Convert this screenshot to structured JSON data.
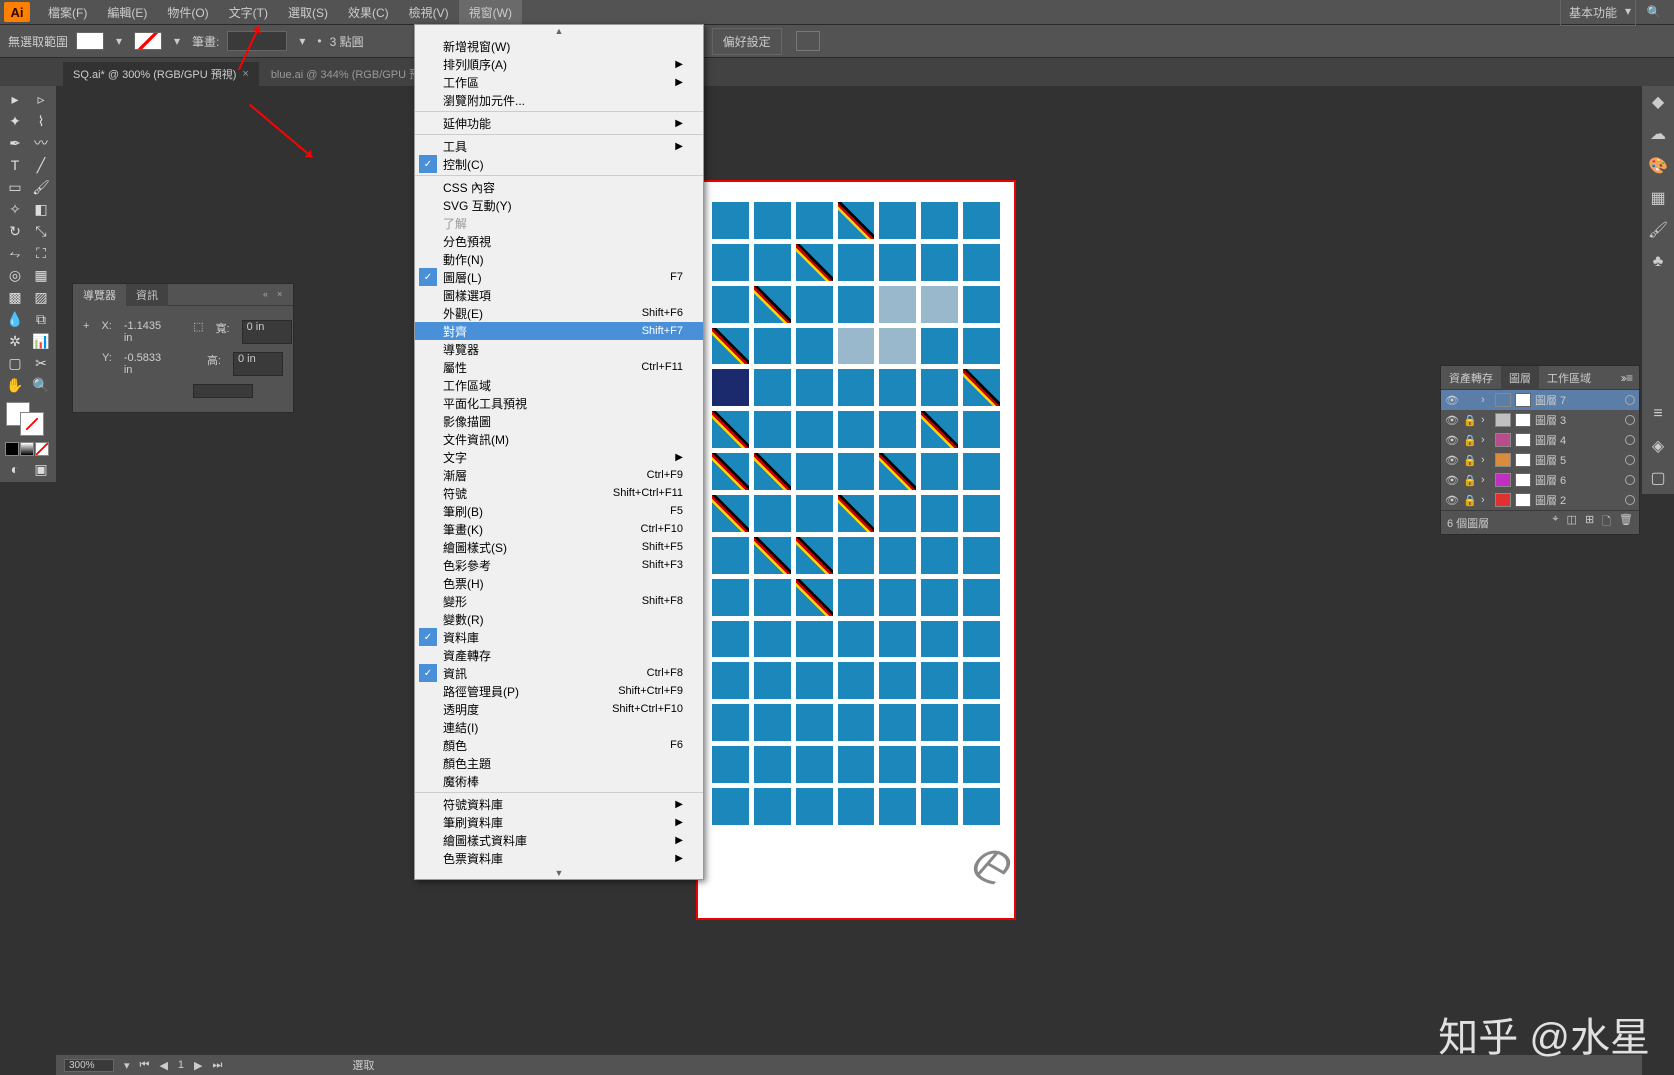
{
  "menubar": {
    "items": [
      "檔案(F)",
      "編輯(E)",
      "物件(O)",
      "文字(T)",
      "選取(S)",
      "效果(C)",
      "檢視(V)",
      "視窗(W)"
    ],
    "workspace": "基本功能"
  },
  "controlbar": {
    "label": "無選取範圍",
    "brush_label": "筆畫:",
    "stroke_value": "",
    "points": "3 點圓",
    "pref": "偏好設定"
  },
  "doctabs": {
    "tabs": [
      {
        "label": "SQ.ai* @ 300% (RGB/GPU 預視)",
        "active": true
      },
      {
        "label": "blue.ai @ 344% (RGB/GPU 預視)",
        "active": false
      }
    ]
  },
  "dropdown": {
    "items": [
      {
        "label": "新增視窗(W)"
      },
      {
        "label": "排列順序(A)",
        "sub": true
      },
      {
        "label": "工作區",
        "sub": true
      },
      {
        "label": "瀏覽附加元件..."
      },
      {
        "sep": true
      },
      {
        "label": "延伸功能",
        "sub": true
      },
      {
        "sep": true
      },
      {
        "label": "工具",
        "sub": true
      },
      {
        "label": "控制(C)",
        "checked": true
      },
      {
        "sep": true
      },
      {
        "label": "CSS 內容"
      },
      {
        "label": "SVG 互動(Y)"
      },
      {
        "label": "了解",
        "disabled": true
      },
      {
        "label": "分色預視"
      },
      {
        "label": "動作(N)"
      },
      {
        "label": "圖層(L)",
        "checked": true,
        "short": "F7"
      },
      {
        "label": "圖樣選項"
      },
      {
        "label": "外觀(E)",
        "short": "Shift+F6"
      },
      {
        "label": "對齊",
        "short": "Shift+F7",
        "highlight": true
      },
      {
        "label": "導覽器"
      },
      {
        "label": "屬性",
        "short": "Ctrl+F11"
      },
      {
        "label": "工作區域"
      },
      {
        "label": "平面化工具預視"
      },
      {
        "label": "影像描圖"
      },
      {
        "label": "文件資訊(M)"
      },
      {
        "label": "文字",
        "sub": true
      },
      {
        "label": "漸層",
        "short": "Ctrl+F9"
      },
      {
        "label": "符號",
        "short": "Shift+Ctrl+F11"
      },
      {
        "label": "筆刷(B)",
        "short": "F5"
      },
      {
        "label": "筆畫(K)",
        "short": "Ctrl+F10"
      },
      {
        "label": "繪圖樣式(S)",
        "short": "Shift+F5"
      },
      {
        "label": "色彩參考",
        "short": "Shift+F3"
      },
      {
        "label": "色票(H)"
      },
      {
        "label": "變形",
        "short": "Shift+F8"
      },
      {
        "label": "變數(R)"
      },
      {
        "label": "資料庫",
        "checked": true
      },
      {
        "label": "資產轉存"
      },
      {
        "label": "資訊",
        "checked": true,
        "short": "Ctrl+F8"
      },
      {
        "label": "路徑管理員(P)",
        "short": "Shift+Ctrl+F9"
      },
      {
        "label": "透明度",
        "short": "Shift+Ctrl+F10"
      },
      {
        "label": "連結(I)"
      },
      {
        "label": "顏色",
        "short": "F6"
      },
      {
        "label": "顏色主題"
      },
      {
        "label": "魔術棒"
      },
      {
        "sep": true
      },
      {
        "label": "符號資料庫",
        "sub": true
      },
      {
        "label": "筆刷資料庫",
        "sub": true
      },
      {
        "label": "繪圖樣式資料庫",
        "sub": true
      },
      {
        "label": "色票資料庫",
        "sub": true
      }
    ]
  },
  "nav_panel": {
    "tabs": [
      "導覽器",
      "資訊"
    ],
    "x_label": "X:",
    "x_value": "-1.1435 in",
    "y_label": "Y:",
    "y_value": "-0.5833 in",
    "w_label": "寬:",
    "w_value": "0 in",
    "h_label": "高:",
    "h_value": "0 in"
  },
  "layers_panel": {
    "tabs": [
      "資產轉存",
      "圖層",
      "工作區域"
    ],
    "active_tab": "圖層",
    "layers": [
      {
        "name": "圖層 7",
        "color": "#5b7ea8",
        "sel": true,
        "locked": false
      },
      {
        "name": "圖層 3",
        "color": "#c0c0c0",
        "locked": true
      },
      {
        "name": "圖層 4",
        "color": "#b84c8c",
        "locked": true
      },
      {
        "name": "圖層 5",
        "color": "#d88c3c",
        "locked": true
      },
      {
        "name": "圖層 6",
        "color": "#c030c0",
        "locked": true
      },
      {
        "name": "圖層 2",
        "color": "#e03030",
        "locked": true
      }
    ],
    "footer": "6 個圖層"
  },
  "statusbar": {
    "zoom": "300%",
    "label": "選取"
  },
  "watermark": "知乎 @水星"
}
